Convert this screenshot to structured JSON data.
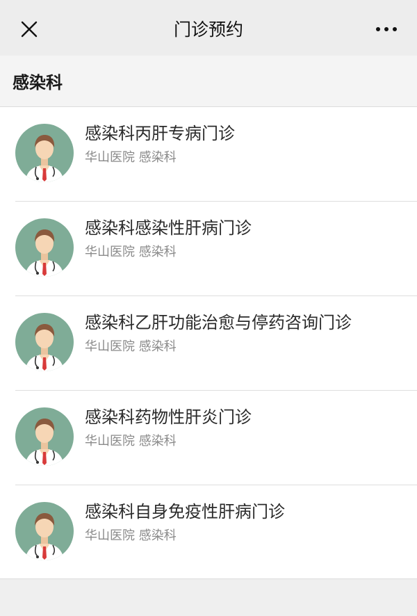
{
  "header": {
    "title": "门诊预约",
    "close_icon": "close-icon",
    "more_icon": "more-icon"
  },
  "section": {
    "title": "感染科"
  },
  "colors": {
    "avatar_bg": "#7fac97",
    "coat": "#ffffff",
    "hair": "#8a5a3e",
    "skin": "#f6d6b5",
    "tie": "#d83b3b"
  },
  "clinics": [
    {
      "name": "感染科丙肝专病门诊",
      "hospital": "华山医院",
      "department": "感染科",
      "avatar": "doctor-avatar-icon"
    },
    {
      "name": "感染科感染性肝病门诊",
      "hospital": "华山医院",
      "department": "感染科",
      "avatar": "doctor-avatar-icon"
    },
    {
      "name": "感染科乙肝功能治愈与停药咨询门诊",
      "hospital": "华山医院",
      "department": "感染科",
      "avatar": "doctor-avatar-icon"
    },
    {
      "name": "感染科药物性肝炎门诊",
      "hospital": "华山医院",
      "department": "感染科",
      "avatar": "doctor-avatar-icon"
    },
    {
      "name": "感染科自身免疫性肝病门诊",
      "hospital": "华山医院",
      "department": "感染科",
      "avatar": "doctor-avatar-icon"
    }
  ]
}
